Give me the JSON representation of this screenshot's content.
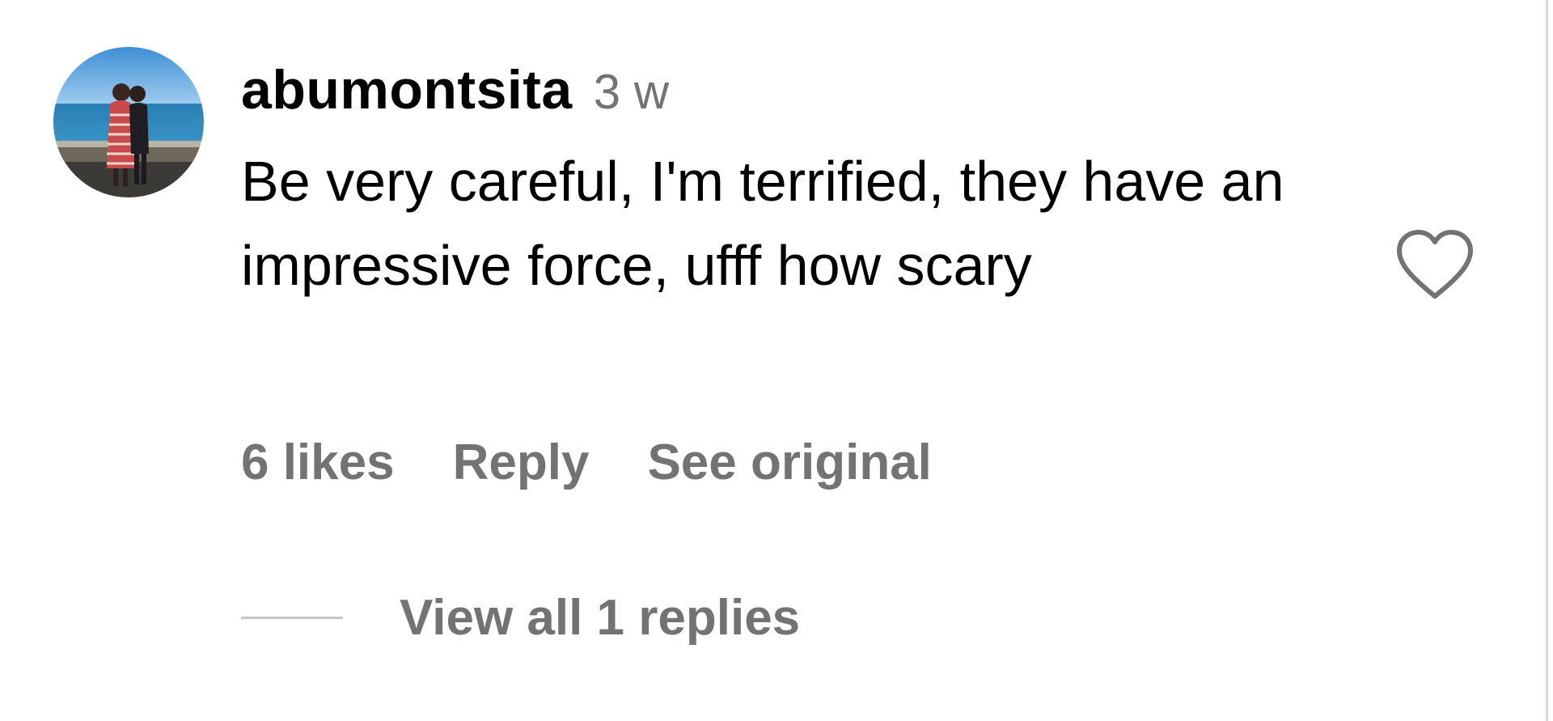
{
  "comment": {
    "username": "abumontsita",
    "timestamp": "3 w",
    "text": "Be very careful, I'm terrified, they have an impressive force, ufff how scary",
    "likes_label": "6 likes",
    "reply_label": "Reply",
    "see_original_label": "See original",
    "view_replies_label": "View all 1 replies",
    "avatar": "profile photo of two people standing by the sea",
    "like_icon": "heart-outline-icon"
  },
  "colors": {
    "primary_text": "#000000",
    "secondary_text": "#737373",
    "divider": "#dbdbdb",
    "reply_line": "#c7c7c7",
    "background": "#ffffff"
  }
}
